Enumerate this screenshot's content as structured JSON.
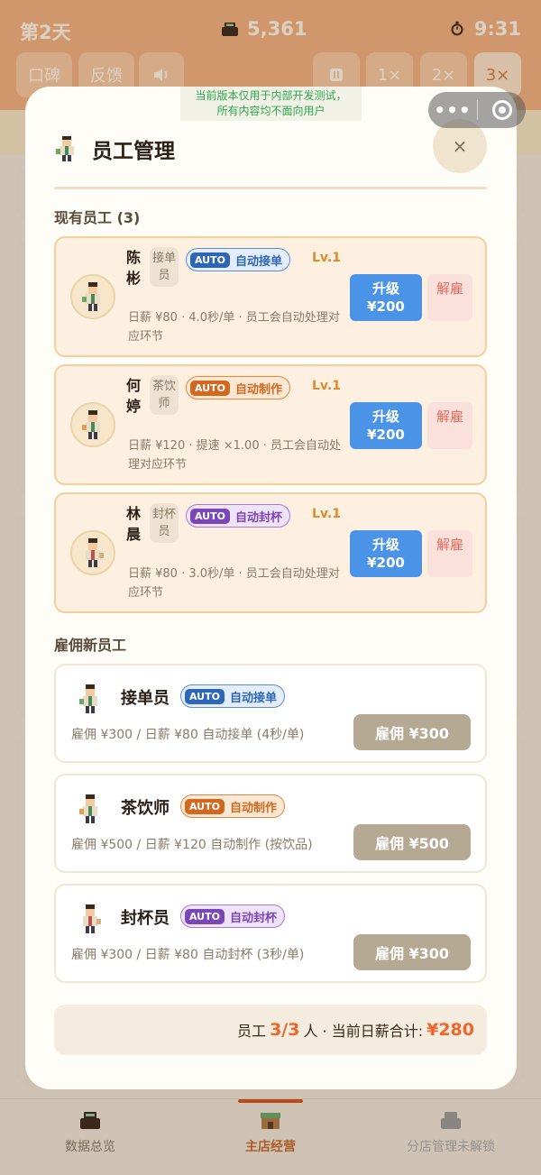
{
  "hud": {
    "day": "第2天",
    "money": "5,361",
    "time": "9:31",
    "buttons": {
      "reputation": "口碑",
      "feedback": "反馈",
      "speed_1x": "1×",
      "speed_2x": "2×",
      "speed_3x": "3×"
    }
  },
  "dev_banner": {
    "line1": "当前版本仅用于内部开发测试，",
    "line2": "所有内容均不面向用户"
  },
  "capsule": {
    "menu": "•••"
  },
  "modal": {
    "title": "员工管理",
    "close": "×",
    "current_section": "现有员工 (3)",
    "employees": [
      {
        "name": "陈彬",
        "role": "接单员",
        "auto": "AUTO",
        "auto_label": "自动接单",
        "level": "Lv.1",
        "desc": "日薪 ¥80 · 4.0秒/单 · 员工会自动处理对应环节",
        "upgrade": "升级",
        "upgrade_price": "¥200",
        "fire": "解雇",
        "color": "blue"
      },
      {
        "name": "何婷",
        "role": "茶饮师",
        "auto": "AUTO",
        "auto_label": "自动制作",
        "level": "Lv.1",
        "desc": "日薪 ¥120 · 提速 ×1.00 · 员工会自动处理对应环节",
        "upgrade": "升级",
        "upgrade_price": "¥200",
        "fire": "解雇",
        "color": "orange"
      },
      {
        "name": "林晨",
        "role": "封杯员",
        "auto": "AUTO",
        "auto_label": "自动封杯",
        "level": "Lv.1",
        "desc": "日薪 ¥80 · 3.0秒/单 · 员工会自动处理对应环节",
        "upgrade": "升级",
        "upgrade_price": "¥200",
        "fire": "解雇",
        "color": "purple"
      }
    ],
    "hire_section": "雇佣新员工",
    "hires": [
      {
        "role": "接单员",
        "auto": "AUTO",
        "auto_label": "自动接单",
        "desc": "雇佣 ¥300 / 日薪 ¥80  自动接单 (4秒/单)",
        "button": "雇佣 ¥300"
      },
      {
        "role": "茶饮师",
        "auto": "AUTO",
        "auto_label": "自动制作",
        "desc": "雇佣 ¥500 / 日薪 ¥120 自动制作 (按饮品)",
        "button": "雇佣 ¥500"
      },
      {
        "role": "封杯员",
        "auto": "AUTO",
        "auto_label": "自动封杯",
        "desc": "雇佣 ¥300 / 日薪 ¥80  自动封杯 (3秒/单)",
        "button": "雇佣 ¥300"
      }
    ],
    "footer": {
      "label": "员工",
      "count": "3/3",
      "unit": "人 · 当前日薪合计:",
      "total": "¥280"
    }
  },
  "nav": {
    "items": [
      {
        "label": "数据总览",
        "icon": "register-icon"
      },
      {
        "label": "主店经营",
        "icon": "shop-icon"
      },
      {
        "label": "分店管理未解锁",
        "icon": "locked-register-icon"
      }
    ]
  },
  "colors": {
    "accent": "#f0652a",
    "upgrade": "#4b93e6",
    "hire": "#b5a994",
    "topbar": "#f0b07e"
  }
}
